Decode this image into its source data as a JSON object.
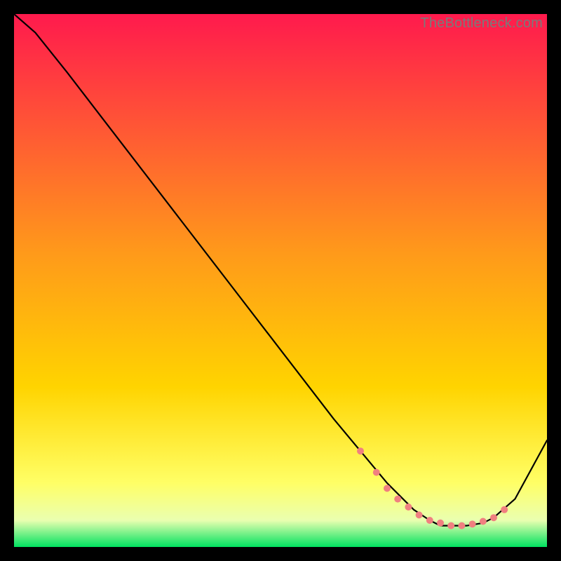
{
  "watermark": "TheBottleneck.com",
  "chart_data": {
    "type": "line",
    "title": "",
    "xlabel": "",
    "ylabel": "",
    "xlim": [
      0,
      100
    ],
    "ylim": [
      0,
      100
    ],
    "background_gradient": {
      "top_color": "#ff1a4d",
      "mid_color": "#ffd400",
      "near_bottom_color": "#ffff66",
      "bottom_color": "#00e260"
    },
    "curve": {
      "x": [
        0,
        4,
        10,
        20,
        30,
        40,
        50,
        60,
        65,
        70,
        75,
        78,
        80,
        82,
        85,
        88,
        90,
        94,
        100
      ],
      "y": [
        100,
        96.5,
        89,
        76,
        63,
        50,
        37,
        24,
        18,
        12,
        7,
        5,
        4,
        4,
        4,
        4.5,
        5.5,
        9,
        20
      ]
    },
    "dots": {
      "x": [
        65,
        68,
        70,
        72,
        74,
        76,
        78,
        80,
        82,
        84,
        86,
        88,
        90,
        92
      ],
      "y": [
        18,
        14,
        11,
        9,
        7.5,
        6,
        5,
        4.5,
        4,
        4,
        4.3,
        4.8,
        5.5,
        7
      ],
      "color": "#f08080",
      "radius": 5
    }
  }
}
